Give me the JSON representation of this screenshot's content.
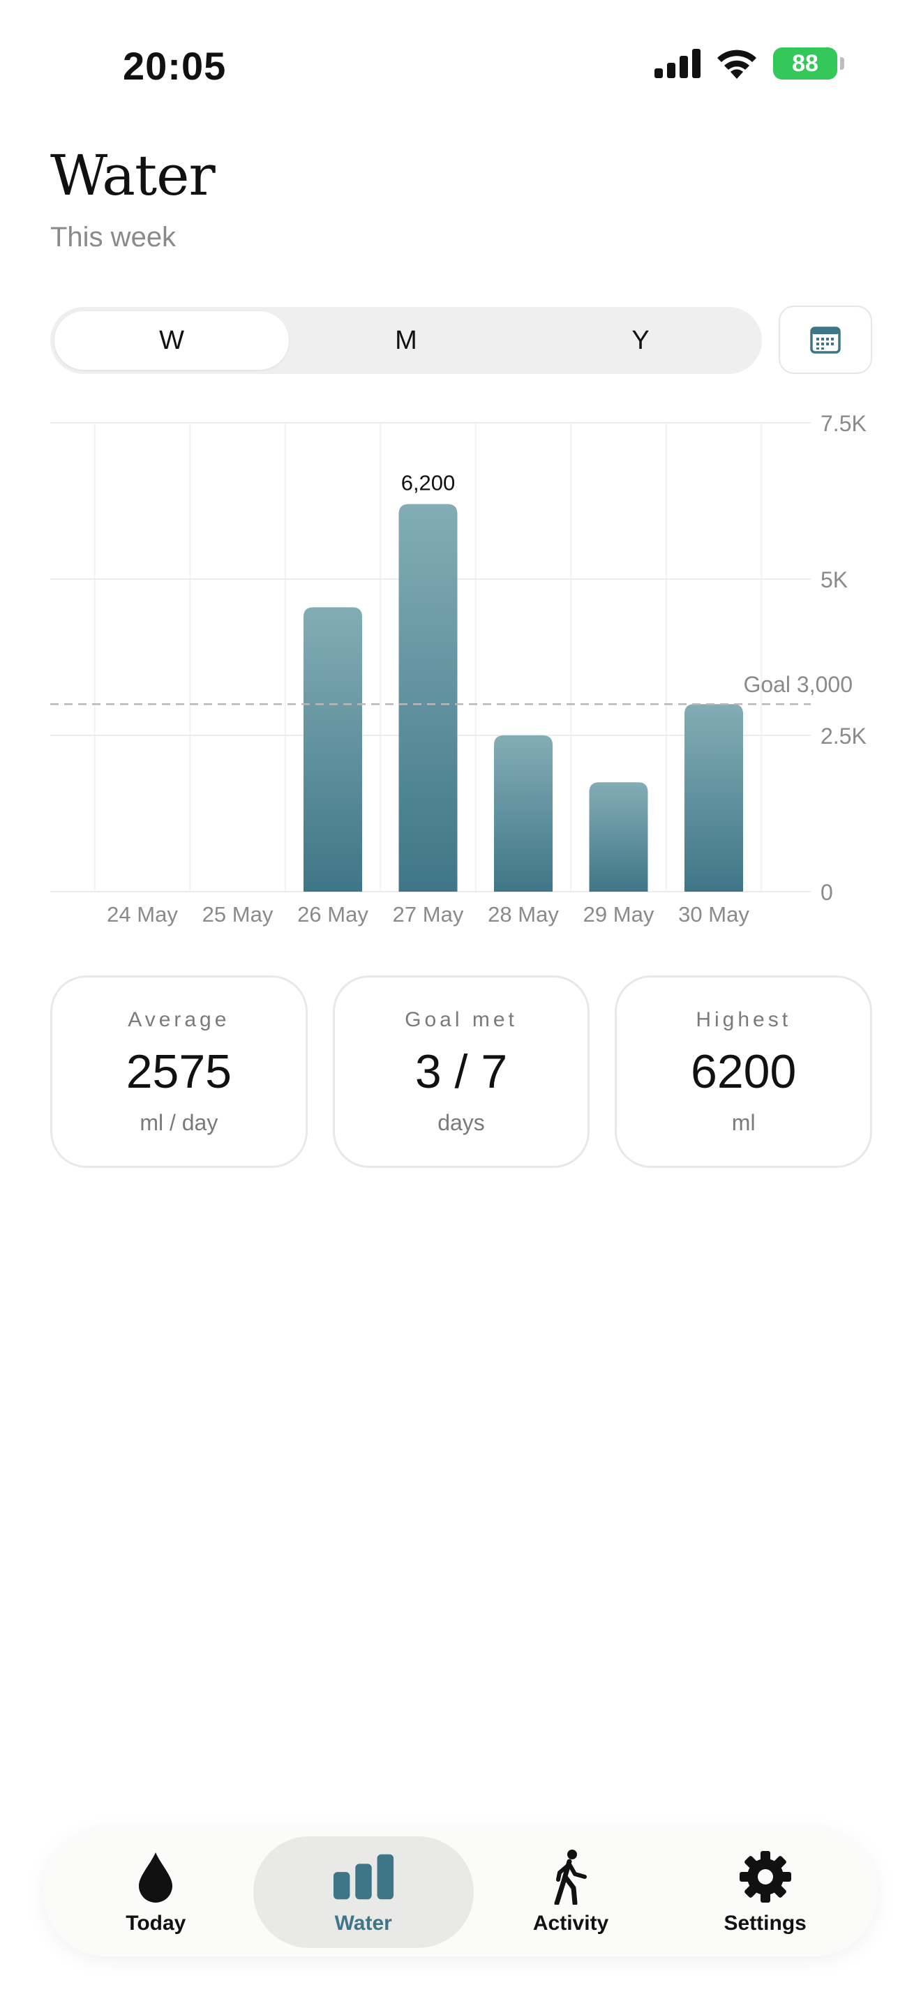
{
  "status": {
    "time": "20:05",
    "battery": "88"
  },
  "header": {
    "title": "Water",
    "subtitle": "This week"
  },
  "range": {
    "options": [
      "W",
      "M",
      "Y"
    ],
    "selected": "W"
  },
  "chart_data": {
    "type": "bar",
    "categories": [
      "24 May",
      "25 May",
      "26 May",
      "27 May",
      "28 May",
      "29 May",
      "30 May"
    ],
    "values": [
      0,
      0,
      4550,
      6200,
      2500,
      1750,
      3000
    ],
    "y_ticks": [
      "0",
      "2.5K",
      "5K",
      "7.5K"
    ],
    "ylim": [
      0,
      7500
    ],
    "goal": {
      "value": 3000,
      "label": "Goal 3,000"
    },
    "highlight": {
      "category": "27 May",
      "label": "6,200"
    },
    "bar_color_top": "#83adb5",
    "bar_color_bottom": "#3f7687",
    "grid": true
  },
  "stats": [
    {
      "label": "Average",
      "value": "2575",
      "unit": "ml / day"
    },
    {
      "label": "Goal met",
      "value": "3 / 7",
      "unit": "days"
    },
    {
      "label": "Highest",
      "value": "6200",
      "unit": "ml"
    }
  ],
  "tabs": [
    {
      "label": "Today",
      "icon": "drop-icon"
    },
    {
      "label": "Water",
      "icon": "bar-chart-icon",
      "active": true
    },
    {
      "label": "Activity",
      "icon": "walking-icon"
    },
    {
      "label": "Settings",
      "icon": "gear-icon"
    }
  ],
  "colors": {
    "accent": "#3f7687",
    "battery": "#34c759"
  }
}
